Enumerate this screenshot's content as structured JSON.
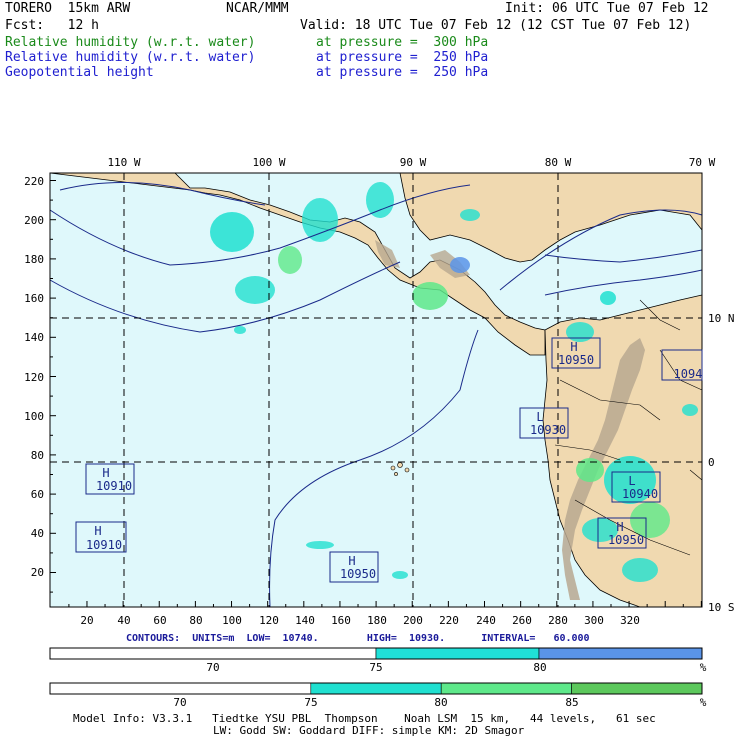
{
  "header": {
    "model": "TORERO  15km ARW",
    "org": "NCAR/MMM",
    "init": "Init: 06 UTC Tue 07 Feb 12",
    "fcst": "Fcst:   12 h",
    "valid": "Valid: 18 UTC Tue 07 Feb 12 (12 CST Tue 07 Feb 12)",
    "fields": [
      {
        "name": "Relative humidity (w.r.t. water)",
        "level": "at pressure =  300 hPa",
        "color": "#1a8a1a"
      },
      {
        "name": "Relative humidity (w.r.t. water)",
        "level": "at pressure =  250 hPa",
        "color": "#2020d0"
      },
      {
        "name": "Geopotential height",
        "level": "at pressure =  250 hPa",
        "color": "#2020d0"
      }
    ]
  },
  "map": {
    "lon_labels": [
      "110 W",
      "100 W",
      "90 W",
      "80 W",
      "70 W"
    ],
    "lat_labels": [
      "10 N",
      "0",
      "10 S"
    ],
    "y_ticks": [
      "220",
      "200",
      "180",
      "160",
      "140",
      "120",
      "100",
      "80",
      "60",
      "40",
      "20"
    ],
    "x_ticks": [
      "20",
      "40",
      "60",
      "80",
      "100",
      "120",
      "140",
      "160",
      "180",
      "200",
      "220",
      "240",
      "260",
      "280",
      "300",
      "320"
    ],
    "colors": {
      "ocean": "#dff8fb",
      "land": "#f0d9b0",
      "mountain": "#b8a890",
      "rh1": "#20e0d0",
      "rh2": "#5a94e8"
    },
    "centers": [
      {
        "type": "H",
        "value": "10950"
      },
      {
        "type": "L",
        "value": "10930"
      },
      {
        "type": "L",
        "value": "10940"
      },
      {
        "type": "H",
        "value": "10950"
      },
      {
        "type": "H",
        "value": "10910"
      },
      {
        "type": "H",
        "value": "10910"
      },
      {
        "type": "H",
        "value": "10950"
      },
      {
        "type": "H",
        "value": "1094"
      }
    ]
  },
  "contours": {
    "text": "CONTOURS:  UNITS=m  LOW=  10740.        HIGH=  10930.      INTERVAL=   60.000"
  },
  "colorbars": [
    {
      "labels": [
        "70",
        "75",
        "80"
      ],
      "unit": "%",
      "segments": [
        {
          "from": 0,
          "to": 0.5,
          "color": "#ffffff"
        },
        {
          "from": 0.5,
          "to": 0.75,
          "color": "#20e0d8"
        },
        {
          "from": 0.75,
          "to": 1,
          "color": "#5a94e8"
        }
      ]
    },
    {
      "labels": [
        "70",
        "75",
        "80",
        "85"
      ],
      "unit": "%",
      "segments": [
        {
          "from": 0,
          "to": 0.4,
          "color": "#ffffff"
        },
        {
          "from": 0.4,
          "to": 0.6,
          "color": "#20e0d0"
        },
        {
          "from": 0.6,
          "to": 0.8,
          "color": "#5ee88a"
        },
        {
          "from": 0.8,
          "to": 1,
          "color": "#5cc85c"
        }
      ]
    }
  ],
  "footer": {
    "line1": "Model Info: V3.3.1   Tiedtke YSU PBL  Thompson    Noah LSM  15 km,   44 levels,   61 sec",
    "line2": "LW: Godd SW: Goddard DIFF: simple KM: 2D Smagor"
  }
}
